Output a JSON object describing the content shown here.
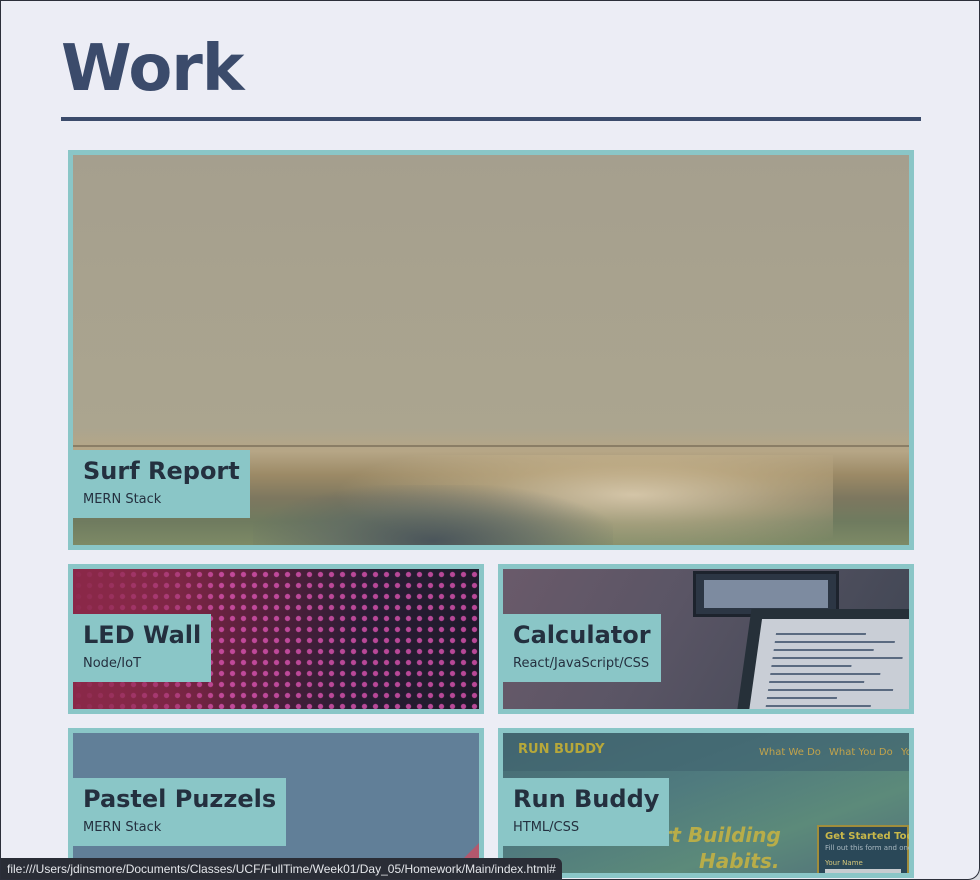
{
  "page": {
    "title": "Work"
  },
  "projects": [
    {
      "title": "Surf Report",
      "tech": "MERN Stack",
      "image_icon": "surf-wave-photo"
    },
    {
      "title": "LED Wall",
      "tech": "Node/IoT",
      "image_icon": "led-wall-photo"
    },
    {
      "title": "Calculator",
      "tech": "React/JavaScript/CSS",
      "image_icon": "laptop-code-photo"
    },
    {
      "title": "Pastel Puzzels",
      "tech": "MERN Stack",
      "image_icon": "pastel-photo"
    },
    {
      "title": "Run Buddy",
      "tech": "HTML/CSS",
      "image_icon": "run-buddy-site-screenshot"
    }
  ],
  "run_buddy_preview": {
    "logo": "RUN BUDDY",
    "nav": [
      "What We Do",
      "What You Do",
      "Yo"
    ],
    "headline_line1": "art Building",
    "headline_line2": "Habits.",
    "form_title": "Get Started Today",
    "form_text": "Fill out this form and one of",
    "form_label": "Your Name"
  },
  "status_bar": {
    "url": "file:///Users/jdinsmore/Documents/Classes/UCF/FullTime/Week01/Day_05/Homework/Main/index.html#"
  },
  "colors": {
    "accent": "#8ac6c7",
    "heading": "#3b4b6b",
    "background": "#ecedf5",
    "label_text": "#24303f"
  }
}
